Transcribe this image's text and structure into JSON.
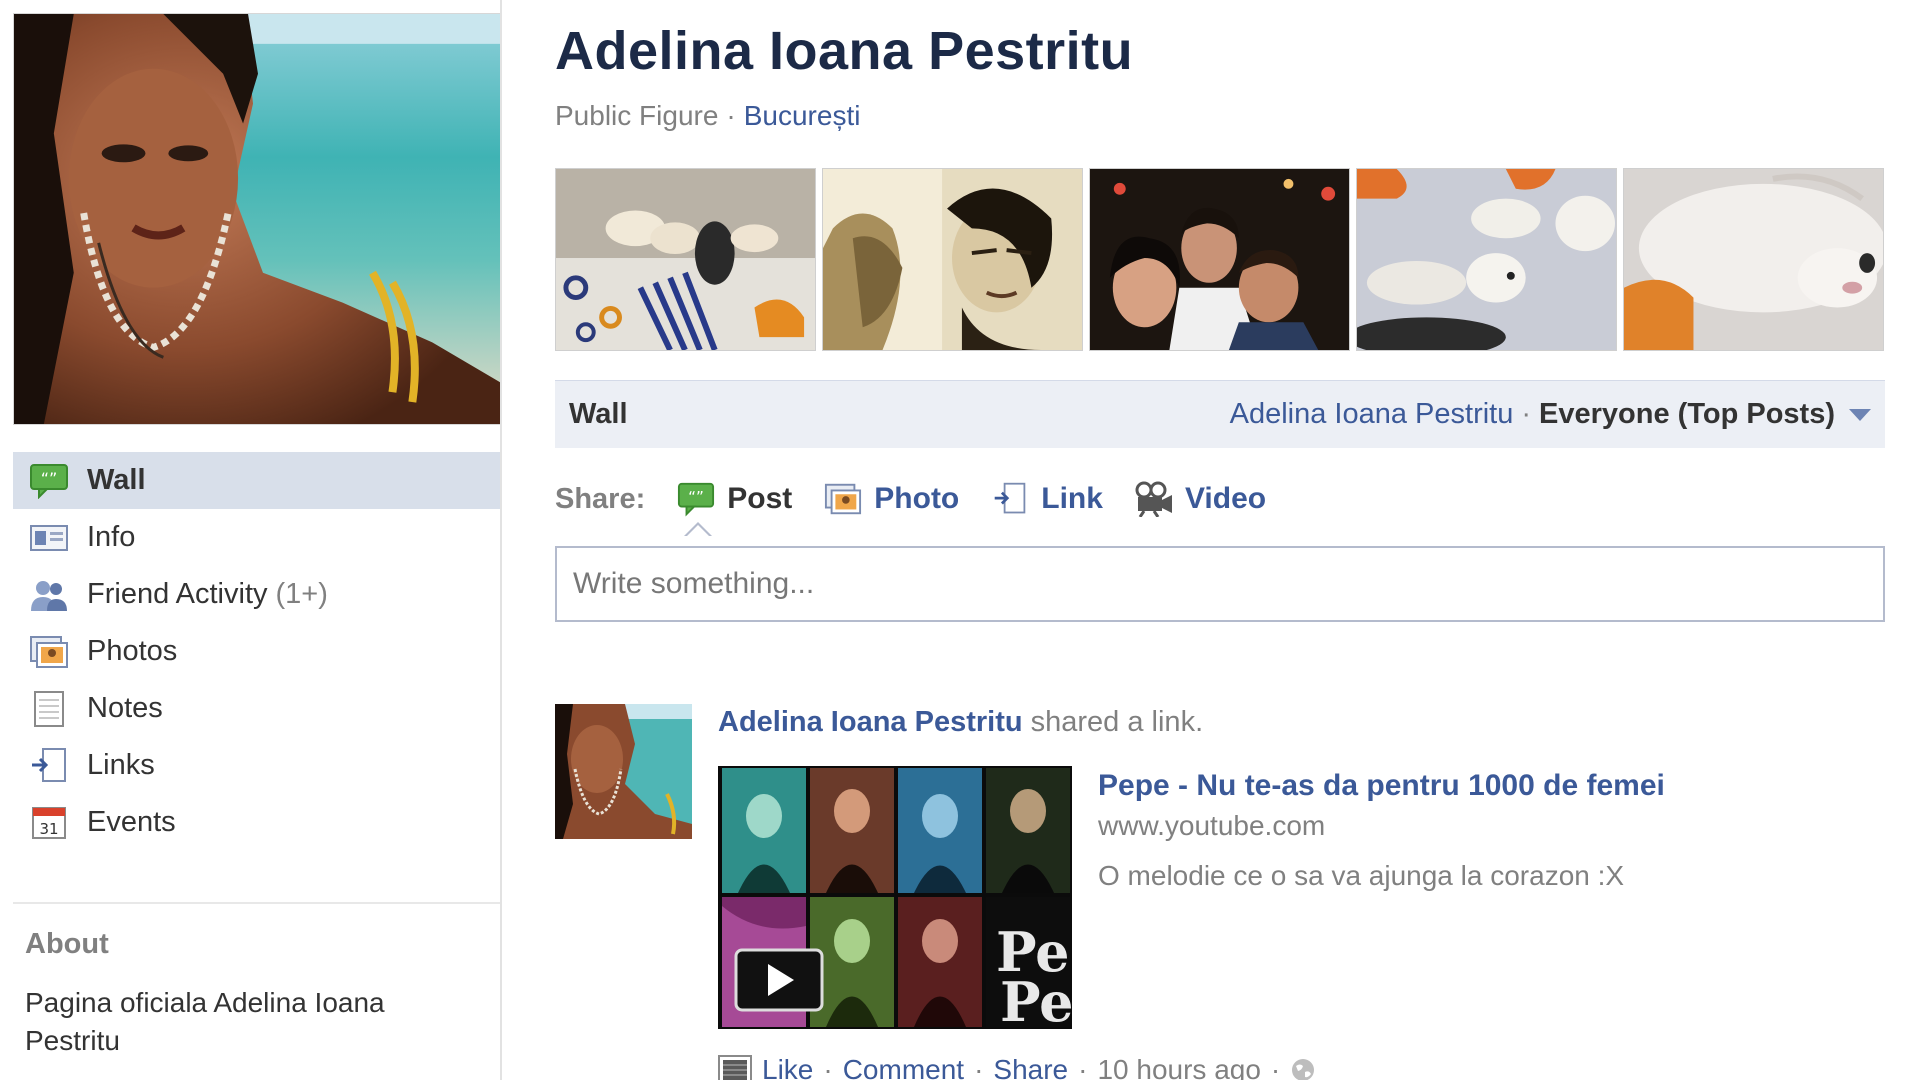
{
  "profile": {
    "name": "Adelina Ioana Pestritu",
    "category": "Public Figure",
    "separator": "·",
    "location": "București"
  },
  "sidebar": {
    "items": [
      {
        "label": "Wall",
        "icon": "wall-icon",
        "active": true,
        "count": ""
      },
      {
        "label": "Info",
        "icon": "info-icon",
        "active": false,
        "count": ""
      },
      {
        "label": "Friend Activity",
        "icon": "friends-icon",
        "active": false,
        "count": "(1+)"
      },
      {
        "label": "Photos",
        "icon": "photos-icon",
        "active": false,
        "count": ""
      },
      {
        "label": "Notes",
        "icon": "notes-icon",
        "active": false,
        "count": ""
      },
      {
        "label": "Links",
        "icon": "links-icon",
        "active": false,
        "count": ""
      },
      {
        "label": "Events",
        "icon": "events-icon",
        "active": false,
        "count": "",
        "icon_text": "31"
      }
    ]
  },
  "about": {
    "title": "About",
    "text": "Pagina oficiala Adelina Ioana Pestritu"
  },
  "wall_bar": {
    "title": "Wall",
    "filter_name": "Adelina Ioana Pestritu",
    "filter_separator": "·",
    "filter_scope": "Everyone (Top Posts)"
  },
  "share": {
    "label": "Share:",
    "options": [
      {
        "label": "Post",
        "icon": "post-icon",
        "active": true
      },
      {
        "label": "Photo",
        "icon": "photo-icon",
        "active": false
      },
      {
        "label": "Link",
        "icon": "link-icon",
        "active": false
      },
      {
        "label": "Video",
        "icon": "video-icon",
        "active": false
      }
    ],
    "placeholder": "Write something..."
  },
  "story": {
    "author": "Adelina Ioana Pestritu",
    "action": " shared a link.",
    "attachment": {
      "title": "Pepe - Nu te-as da pentru 1000 de femei",
      "domain": "www.youtube.com",
      "description": "O melodie ce o sa va ajunga la corazon :X",
      "thumb_text": "Pe",
      "play_icon": "play-icon"
    },
    "actions": {
      "like": "Like",
      "comment": "Comment",
      "share": "Share",
      "time": "10 hours ago",
      "separator": "·",
      "privacy_icon": "globe-icon"
    }
  },
  "colors": {
    "link_blue": "#3b5998",
    "title_navy": "#1c2a47",
    "active_nav_bg": "#d8dfea",
    "wall_bar_bg": "#eceff5",
    "muted_gray": "#808080"
  }
}
